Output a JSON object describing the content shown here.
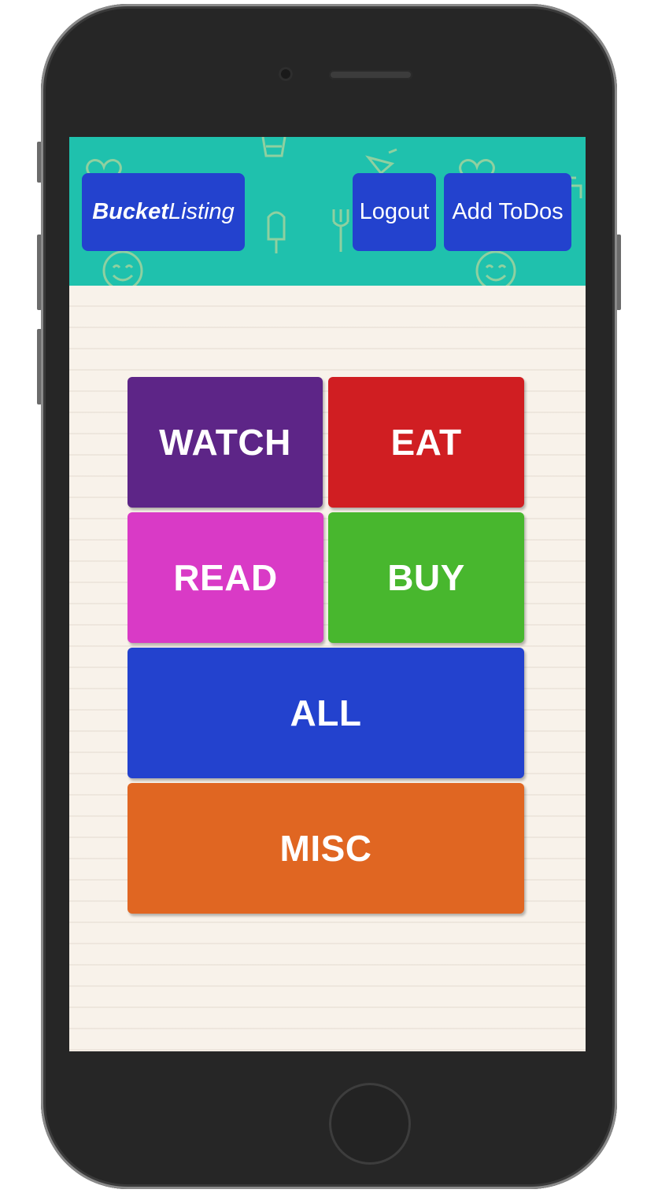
{
  "header": {
    "brand_bold": "Bucket",
    "brand_light": "Listing",
    "logout_label": "Logout",
    "add_todos_label": "Add ToDos",
    "background_color": "#1fc1ad",
    "button_color": "#2342ce"
  },
  "categories": [
    {
      "label": "WATCH",
      "color": "#5d2587"
    },
    {
      "label": "EAT",
      "color": "#d01e22"
    },
    {
      "label": "READ",
      "color": "#d93ac6"
    },
    {
      "label": "BUY",
      "color": "#48b72e"
    },
    {
      "label": "ALL",
      "color": "#2342ce"
    },
    {
      "label": "MISC",
      "color": "#e06622"
    }
  ]
}
